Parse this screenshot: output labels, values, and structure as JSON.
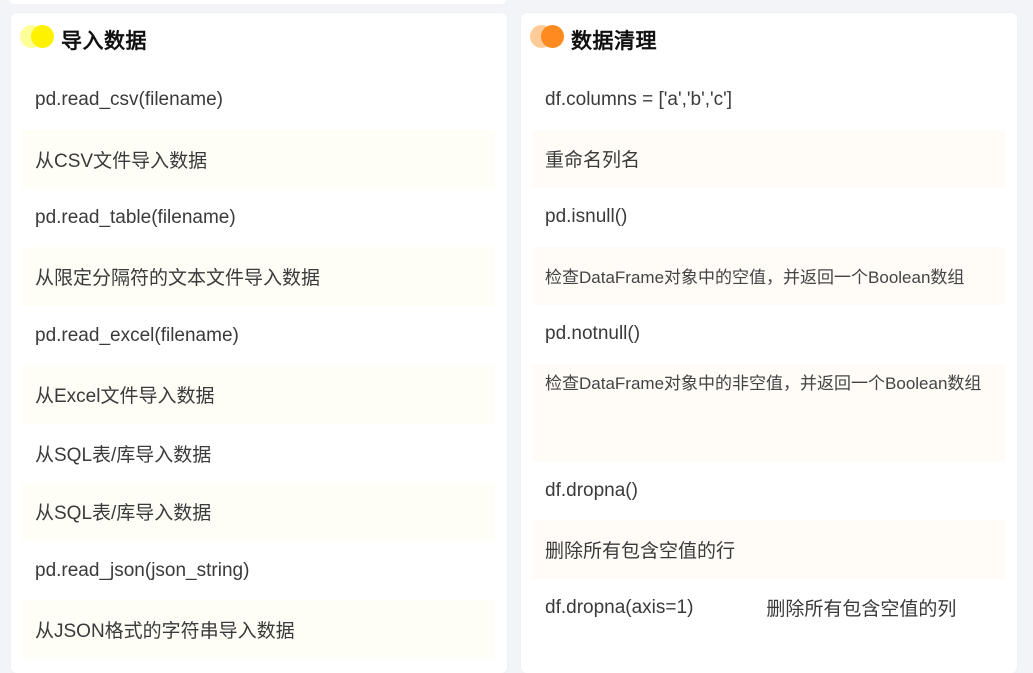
{
  "colors": {
    "left_dot_a": "#ffff99",
    "left_dot_b": "#fff200",
    "right_dot_a": "#ffcc99",
    "right_dot_b": "#ff8a1f",
    "left_row_shade": "#fefef6",
    "right_row_shade": "#fffbf7"
  },
  "left_card": {
    "title": "导入数据",
    "rows": [
      "pd.read_csv(filename)",
      "从CSV文件导入数据",
      "pd.read_table(filename)",
      "从限定分隔符的文本文件导入数据",
      "pd.read_excel(filename)",
      "从Excel文件导入数据",
      "从SQL表/库导入数据",
      "从SQL表/库导入数据",
      "pd.read_json(json_string)",
      "从JSON格式的字符串导入数据"
    ]
  },
  "right_card": {
    "title": "数据清理",
    "rows": [
      "df.columns = ['a','b','c']",
      "重命名列名",
      "pd.isnull()",
      "检查DataFrame对象中的空值，并返回一个Boolean数组",
      "pd.notnull()",
      "检查DataFrame对象中的非空值，并返回一个Boolean数组",
      "df.dropna()",
      "删除所有包含空值的行",
      "df.dropna(axis=1)",
      "删除所有包含空值的列"
    ]
  }
}
